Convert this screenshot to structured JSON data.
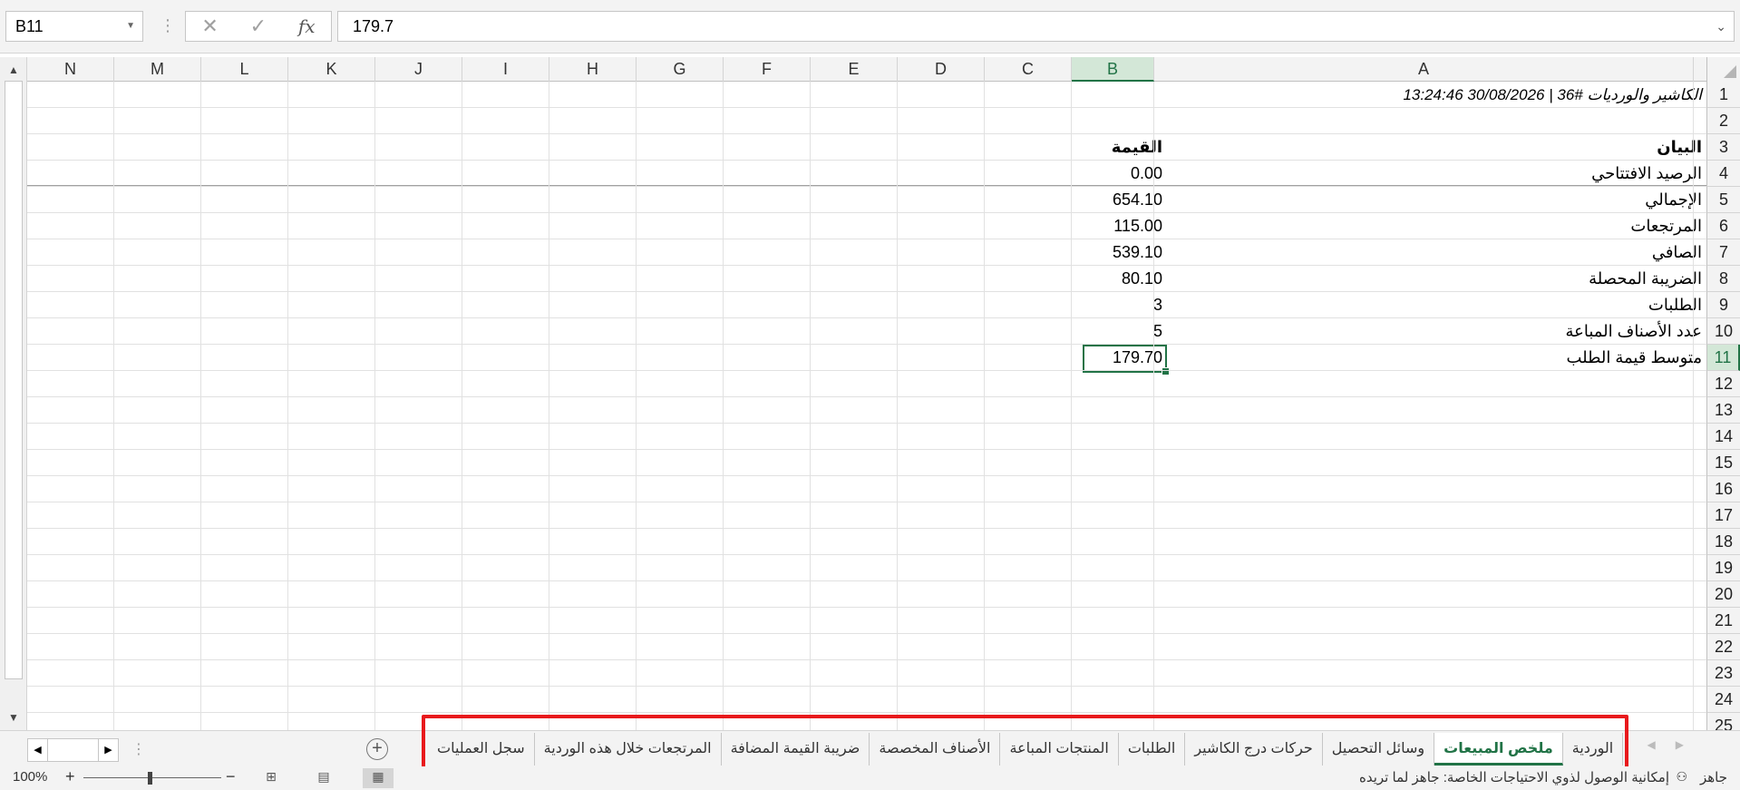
{
  "formula_bar": {
    "name_box": "B11",
    "formula": "179.7",
    "icons": [
      "cancel-icon",
      "enter-icon",
      "fx-icon"
    ]
  },
  "columns": [
    "N",
    "M",
    "L",
    "K",
    "J",
    "I",
    "H",
    "G",
    "F",
    "E",
    "D",
    "C",
    "B",
    "A"
  ],
  "selected_column": "B",
  "rows": [
    "1",
    "2",
    "3",
    "4",
    "5",
    "6",
    "7",
    "8",
    "9",
    "10",
    "11",
    "12",
    "13",
    "14",
    "15",
    "16",
    "17",
    "18",
    "19",
    "20",
    "21",
    "22",
    "23",
    "24",
    "25"
  ],
  "selected_row": "11",
  "sheet": {
    "title": "الكاشير والورديات #36   |  30/08/2026 13:24:46",
    "header_label": "البيان",
    "header_value": "القيمة",
    "rows": [
      {
        "label": "الرصيد الافتتاحي",
        "value": "0.00"
      },
      {
        "label": "الإجمالي",
        "value": "654.10"
      },
      {
        "label": "المرتجعات",
        "value": "115.00"
      },
      {
        "label": "الصافي",
        "value": "539.10"
      },
      {
        "label": "الضريبة المحصلة",
        "value": "80.10"
      },
      {
        "label": "الطلبات",
        "value": "3"
      },
      {
        "label": "عدد الأصناف المباعة",
        "value": "5"
      },
      {
        "label": "متوسط قيمة الطلب",
        "value": "179.70"
      }
    ]
  },
  "tabs": [
    {
      "label": "الوردية",
      "active": false
    },
    {
      "label": "ملخص المبيعات",
      "active": true
    },
    {
      "label": "وسائل التحصيل",
      "active": false
    },
    {
      "label": "حركات درج الكاشير",
      "active": false
    },
    {
      "label": "الطلبات",
      "active": false
    },
    {
      "label": "المنتجات المباعة",
      "active": false
    },
    {
      "label": "الأصناف المخصصة",
      "active": false
    },
    {
      "label": "ضريبة القيمة المضافة",
      "active": false
    },
    {
      "label": "المرتجعات خلال هذه الوردية",
      "active": false
    },
    {
      "label": "سجل العمليات",
      "active": false
    }
  ],
  "status_bar": {
    "ready": "جاهز",
    "accessibility": "إمكانية الوصول لذوي الاحتياجات الخاصة: جاهز لما تريده",
    "zoom": "100%",
    "zoom_minus": "−",
    "zoom_plus": "+"
  },
  "colors": {
    "accent": "#217346",
    "highlight": "#e8191c"
  }
}
